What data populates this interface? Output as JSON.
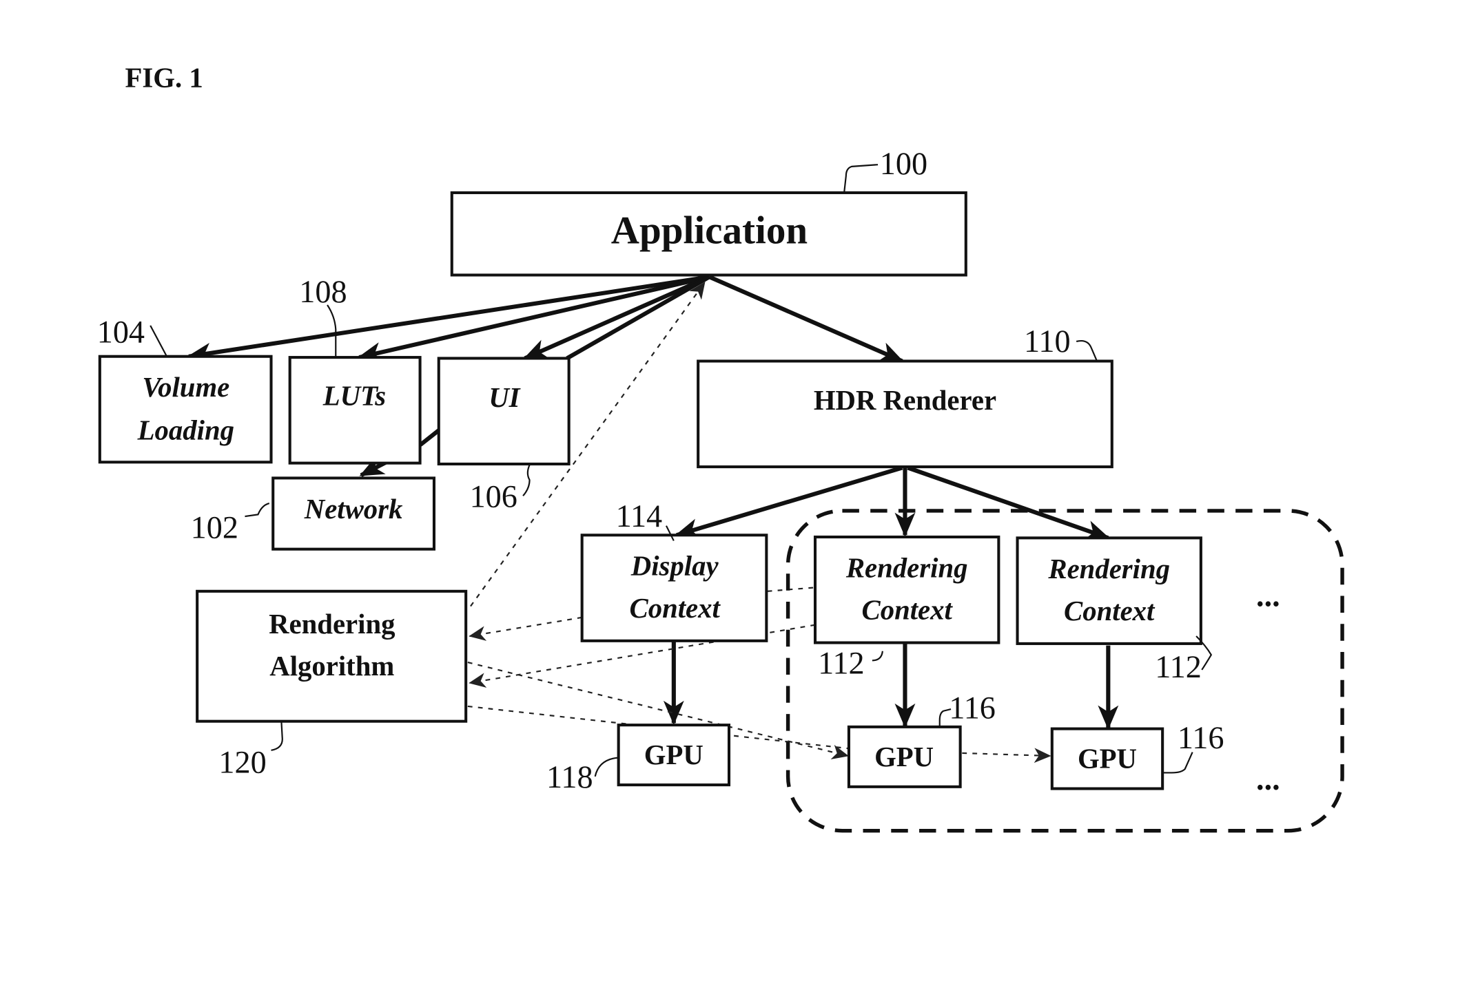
{
  "figure_title": "FIG. 1",
  "nodes": {
    "application": {
      "label": "Application",
      "ref": "100"
    },
    "volume_loading": {
      "label_line1": "Volume",
      "label_line2": "Loading",
      "ref": "104"
    },
    "luts": {
      "label": "LUTs",
      "ref": "108"
    },
    "ui": {
      "label": "UI",
      "ref": "106"
    },
    "network": {
      "label": "Network",
      "ref": "102"
    },
    "hdr_renderer": {
      "label": "HDR Renderer",
      "ref": "110"
    },
    "rendering_algorithm": {
      "label_line1": "Rendering",
      "label_line2": "Algorithm",
      "ref": "120"
    },
    "display_context": {
      "label_line1": "Display",
      "label_line2": "Context",
      "ref": "114"
    },
    "rendering_context_1": {
      "label_line1": "Rendering",
      "label_line2": "Context",
      "ref": "112"
    },
    "rendering_context_2": {
      "label_line1": "Rendering",
      "label_line2": "Context",
      "ref": "112"
    },
    "gpu_display": {
      "label": "GPU",
      "ref": "118"
    },
    "gpu_1": {
      "label": "GPU",
      "ref": "116"
    },
    "gpu_2": {
      "label": "GPU",
      "ref": "116"
    }
  },
  "ellipsis": "...",
  "edges": [
    {
      "from": "application",
      "to": "volume_loading",
      "style": "solid"
    },
    {
      "from": "application",
      "to": "luts",
      "style": "solid"
    },
    {
      "from": "application",
      "to": "ui",
      "style": "solid"
    },
    {
      "from": "application",
      "to": "hdr_renderer",
      "style": "solid"
    },
    {
      "from": "ui",
      "to": "network",
      "style": "solid"
    },
    {
      "from": "rendering_algorithm",
      "to": "application",
      "style": "dashed"
    },
    {
      "from": "hdr_renderer",
      "to": "display_context",
      "style": "solid"
    },
    {
      "from": "hdr_renderer",
      "to": "rendering_context_1",
      "style": "solid"
    },
    {
      "from": "hdr_renderer",
      "to": "rendering_context_2",
      "style": "solid"
    },
    {
      "from": "display_context",
      "to": "gpu_display",
      "style": "solid"
    },
    {
      "from": "rendering_context_1",
      "to": "gpu_1",
      "style": "solid"
    },
    {
      "from": "rendering_context_2",
      "to": "gpu_2",
      "style": "solid"
    },
    {
      "from": "display_context",
      "to": "rendering_algorithm",
      "style": "dashed"
    },
    {
      "from": "rendering_context_1",
      "to": "rendering_algorithm",
      "style": "dashed"
    },
    {
      "from": "rendering_algorithm",
      "to": "gpu_1",
      "style": "dashed"
    },
    {
      "from": "gpu_1",
      "to": "gpu_2",
      "style": "dashed"
    }
  ]
}
